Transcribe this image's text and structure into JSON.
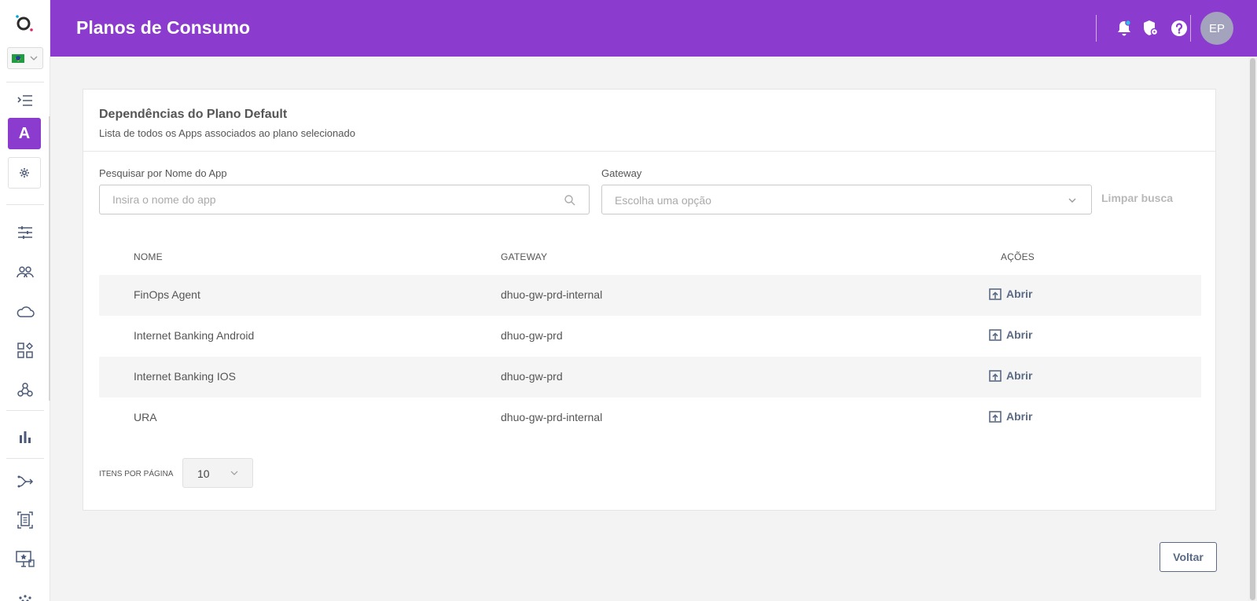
{
  "header": {
    "title": "Planos de Consumo",
    "avatar_initials": "EP",
    "accent_color": "#8b3ccf"
  },
  "sidebar": {
    "language": "pt-BR",
    "active_item_letter": "A",
    "items": [
      {
        "icon": "menu-expand-icon"
      },
      {
        "icon": "app-a-icon"
      },
      {
        "icon": "gear-icon"
      },
      {
        "icon": "sliders-icon"
      },
      {
        "icon": "users-icon"
      },
      {
        "icon": "cloud-icon"
      },
      {
        "icon": "apps-grid-icon"
      },
      {
        "icon": "webhook-icon"
      },
      {
        "icon": "bar-chart-icon"
      },
      {
        "icon": "flow-icon"
      },
      {
        "icon": "document-scan-icon"
      },
      {
        "icon": "monitor-star-icon"
      }
    ]
  },
  "card": {
    "title": "Dependências do Plano Default",
    "subtitle": "Lista de todos os Apps associados ao plano selecionado"
  },
  "filters": {
    "search_label": "Pesquisar por Nome do App",
    "search_placeholder": "Insira o nome do app",
    "search_value": "",
    "gateway_label": "Gateway",
    "gateway_placeholder": "Escolha uma opção",
    "clear_label": "Limpar busca"
  },
  "table": {
    "columns": [
      "NOME",
      "GATEWAY",
      "AÇÕES"
    ],
    "rows": [
      {
        "nome": "FinOps Agent",
        "gateway": "dhuo-gw-prd-internal",
        "action": "Abrir"
      },
      {
        "nome": "Internet Banking Android",
        "gateway": "dhuo-gw-prd",
        "action": "Abrir"
      },
      {
        "nome": "Internet Banking IOS",
        "gateway": "dhuo-gw-prd",
        "action": "Abrir"
      },
      {
        "nome": "URA",
        "gateway": "dhuo-gw-prd-internal",
        "action": "Abrir"
      }
    ]
  },
  "pagination": {
    "items_per_page_label": "ITENS POR PÁGINA",
    "items_per_page_value": "10"
  },
  "footer": {
    "back_label": "Voltar"
  }
}
